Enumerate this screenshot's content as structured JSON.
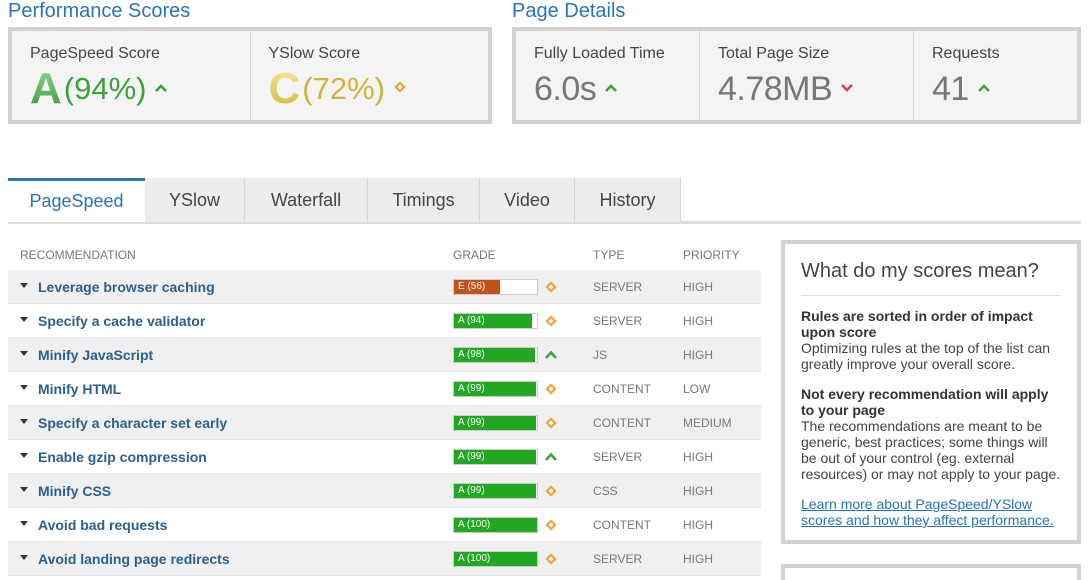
{
  "performance": {
    "title": "Performance Scores",
    "pagespeed": {
      "label": "PageSpeed Score",
      "grade": "A",
      "percent": "(94%)",
      "trend": "up"
    },
    "yslow": {
      "label": "YSlow Score",
      "grade": "C",
      "percent": "(72%)",
      "trend": "same"
    }
  },
  "page_details": {
    "title": "Page Details",
    "loaded": {
      "label": "Fully Loaded Time",
      "value": "6.0s",
      "trend": "up"
    },
    "size": {
      "label": "Total Page Size",
      "value": "4.78MB",
      "trend": "down"
    },
    "requests": {
      "label": "Requests",
      "value": "41",
      "trend": "up"
    }
  },
  "tabs": [
    "PageSpeed",
    "YSlow",
    "Waterfall",
    "Timings",
    "Video",
    "History"
  ],
  "table": {
    "headers": {
      "recommendation": "RECOMMENDATION",
      "grade": "GRADE",
      "type": "TYPE",
      "priority": "PRIORITY"
    },
    "rows": [
      {
        "name": "Leverage browser caching",
        "grade": "E (56)",
        "score": 56,
        "type": "SERVER",
        "priority": "HIGH",
        "trend": "same"
      },
      {
        "name": "Specify a cache validator",
        "grade": "A (94)",
        "score": 94,
        "type": "SERVER",
        "priority": "HIGH",
        "trend": "same"
      },
      {
        "name": "Minify JavaScript",
        "grade": "A (98)",
        "score": 98,
        "type": "JS",
        "priority": "HIGH",
        "trend": "up"
      },
      {
        "name": "Minify HTML",
        "grade": "A (99)",
        "score": 99,
        "type": "CONTENT",
        "priority": "LOW",
        "trend": "same"
      },
      {
        "name": "Specify a character set early",
        "grade": "A (99)",
        "score": 99,
        "type": "CONTENT",
        "priority": "MEDIUM",
        "trend": "same"
      },
      {
        "name": "Enable gzip compression",
        "grade": "A (99)",
        "score": 99,
        "type": "SERVER",
        "priority": "HIGH",
        "trend": "up"
      },
      {
        "name": "Minify CSS",
        "grade": "A (99)",
        "score": 99,
        "type": "CSS",
        "priority": "HIGH",
        "trend": "same"
      },
      {
        "name": "Avoid bad requests",
        "grade": "A (100)",
        "score": 100,
        "type": "CONTENT",
        "priority": "HIGH",
        "trend": "same"
      },
      {
        "name": "Avoid landing page redirects",
        "grade": "A (100)",
        "score": 100,
        "type": "SERVER",
        "priority": "HIGH",
        "trend": "same"
      }
    ]
  },
  "sidebar": {
    "title": "What do my scores mean?",
    "p1_bold": "Rules are sorted in order of impact upon score",
    "p1_text": "Optimizing rules at the top of the list can greatly improve your overall score.",
    "p2_bold": "Not every recommendation will apply to your page",
    "p2_text": "The recommendations are meant to be generic, best practices; some things will be out of your control (eg. external resources) or may not apply to your page.",
    "link": "Learn more about PageSpeed/YSlow scores and how they affect performance."
  },
  "colors": {
    "accent": "#2774b9",
    "grade_a": "#22a722",
    "grade_e": "#c4501b",
    "trend_up": "#3aa33a",
    "trend_down": "#e0415a",
    "trend_same": "#f0a53a"
  }
}
